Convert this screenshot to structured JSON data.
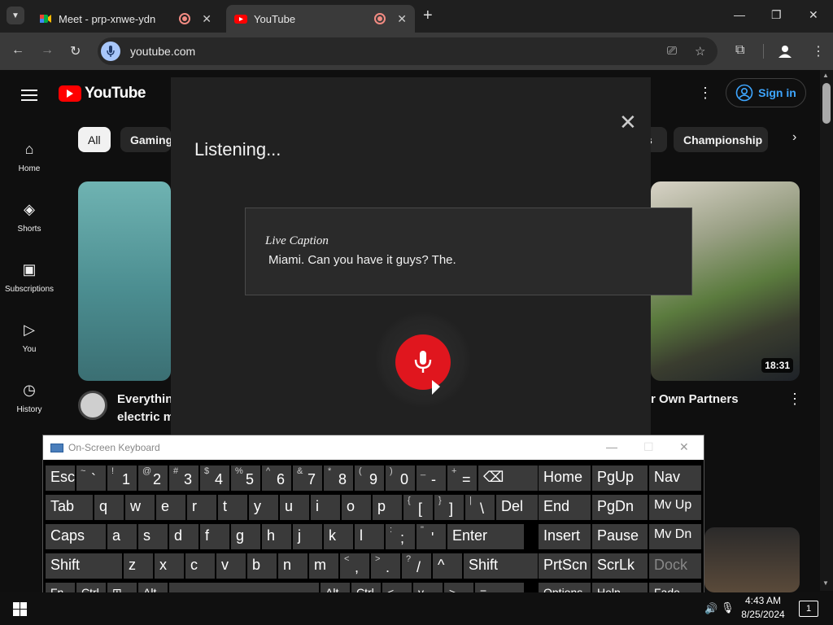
{
  "browser": {
    "tabs": [
      {
        "title": "Meet - prp-xnwe-ydn",
        "close": "✕"
      },
      {
        "title": "YouTube",
        "close": "✕"
      }
    ],
    "new_tab": "+",
    "url": "youtube.com",
    "window_controls": {
      "minimize": "—",
      "maximize": "❐",
      "close": "✕"
    },
    "nav": {
      "back": "←",
      "forward": "→",
      "reload": "↻"
    }
  },
  "youtube": {
    "logo_text": "YouTube",
    "sign_in": "Sign in",
    "sidebar": [
      {
        "label": "Home",
        "icon": "⌂"
      },
      {
        "label": "Shorts",
        "icon": "◈"
      },
      {
        "label": "Subscriptions",
        "icon": "▣"
      },
      {
        "label": "You",
        "icon": "▷"
      },
      {
        "label": "History",
        "icon": "◷"
      }
    ],
    "chips": [
      "All",
      "Gaming",
      "s",
      "Championship"
    ],
    "videos": [
      {
        "title_line1": "Everythin",
        "title_line2": "electric m"
      },
      {
        "title": "r Own Partners",
        "duration": "18:31"
      }
    ]
  },
  "voice_search": {
    "status": "Listening...",
    "caption_label": "Live Caption",
    "caption_text": "Miami. Can you have it guys? The."
  },
  "osk": {
    "title": "On-Screen Keyboard",
    "rows": [
      [
        {
          "main": "Esc"
        },
        {
          "sup": "~",
          "main": "`"
        },
        {
          "sup": "!",
          "main": "1"
        },
        {
          "sup": "@",
          "main": "2"
        },
        {
          "sup": "#",
          "main": "3"
        },
        {
          "sup": "$",
          "main": "4"
        },
        {
          "sup": "%",
          "main": "5"
        },
        {
          "sup": "^",
          "main": "6"
        },
        {
          "sup": "&",
          "main": "7"
        },
        {
          "sup": "*",
          "main": "8"
        },
        {
          "sup": "(",
          "main": "9"
        },
        {
          "sup": ")",
          "main": "0"
        },
        {
          "sup": "_",
          "main": "-"
        },
        {
          "sup": "+",
          "main": "="
        },
        {
          "main": "⌫"
        }
      ],
      [
        {
          "main": "Tab"
        },
        {
          "main": "q"
        },
        {
          "main": "w"
        },
        {
          "main": "e"
        },
        {
          "main": "r"
        },
        {
          "main": "t"
        },
        {
          "main": "y"
        },
        {
          "main": "u"
        },
        {
          "main": "i"
        },
        {
          "main": "o"
        },
        {
          "main": "p"
        },
        {
          "sup": "{",
          "main": "["
        },
        {
          "sup": "}",
          "main": "]"
        },
        {
          "sup": "|",
          "main": "\\"
        },
        {
          "main": "Del"
        }
      ],
      [
        {
          "main": "Caps"
        },
        {
          "main": "a"
        },
        {
          "main": "s"
        },
        {
          "main": "d"
        },
        {
          "main": "f"
        },
        {
          "main": "g"
        },
        {
          "main": "h"
        },
        {
          "main": "j"
        },
        {
          "main": "k"
        },
        {
          "main": "l"
        },
        {
          "sup": ":",
          "main": ";"
        },
        {
          "sup": "\"",
          "main": "'"
        },
        {
          "main": "Enter"
        }
      ],
      [
        {
          "main": "Shift"
        },
        {
          "main": "z"
        },
        {
          "main": "x"
        },
        {
          "main": "c"
        },
        {
          "main": "v"
        },
        {
          "main": "b"
        },
        {
          "main": "n"
        },
        {
          "main": "m"
        },
        {
          "sup": "<",
          "main": ","
        },
        {
          "sup": ">",
          "main": "."
        },
        {
          "sup": "?",
          "main": "/"
        },
        {
          "main": "^"
        },
        {
          "main": "Shift"
        }
      ],
      [
        {
          "main": "Fn"
        },
        {
          "main": "Ctrl"
        },
        {
          "main": "⊞"
        },
        {
          "main": "Alt"
        },
        {
          "main": ""
        },
        {
          "main": "Alt"
        },
        {
          "main": "Ctrl"
        },
        {
          "main": "<"
        },
        {
          "main": "v"
        },
        {
          "main": ">"
        },
        {
          "main": "≡"
        }
      ]
    ],
    "nav_keys": [
      [
        "Home",
        "PgUp",
        "Nav"
      ],
      [
        "End",
        "PgDn",
        "Mv Up"
      ],
      [
        "Insert",
        "Pause",
        "Mv Dn"
      ],
      [
        "PrtScn",
        "ScrLk",
        "Dock"
      ],
      [
        "Options",
        "Help",
        "Fade"
      ]
    ]
  },
  "taskbar": {
    "time": "4:43 AM",
    "date": "8/25/2024",
    "notifications": "1"
  }
}
